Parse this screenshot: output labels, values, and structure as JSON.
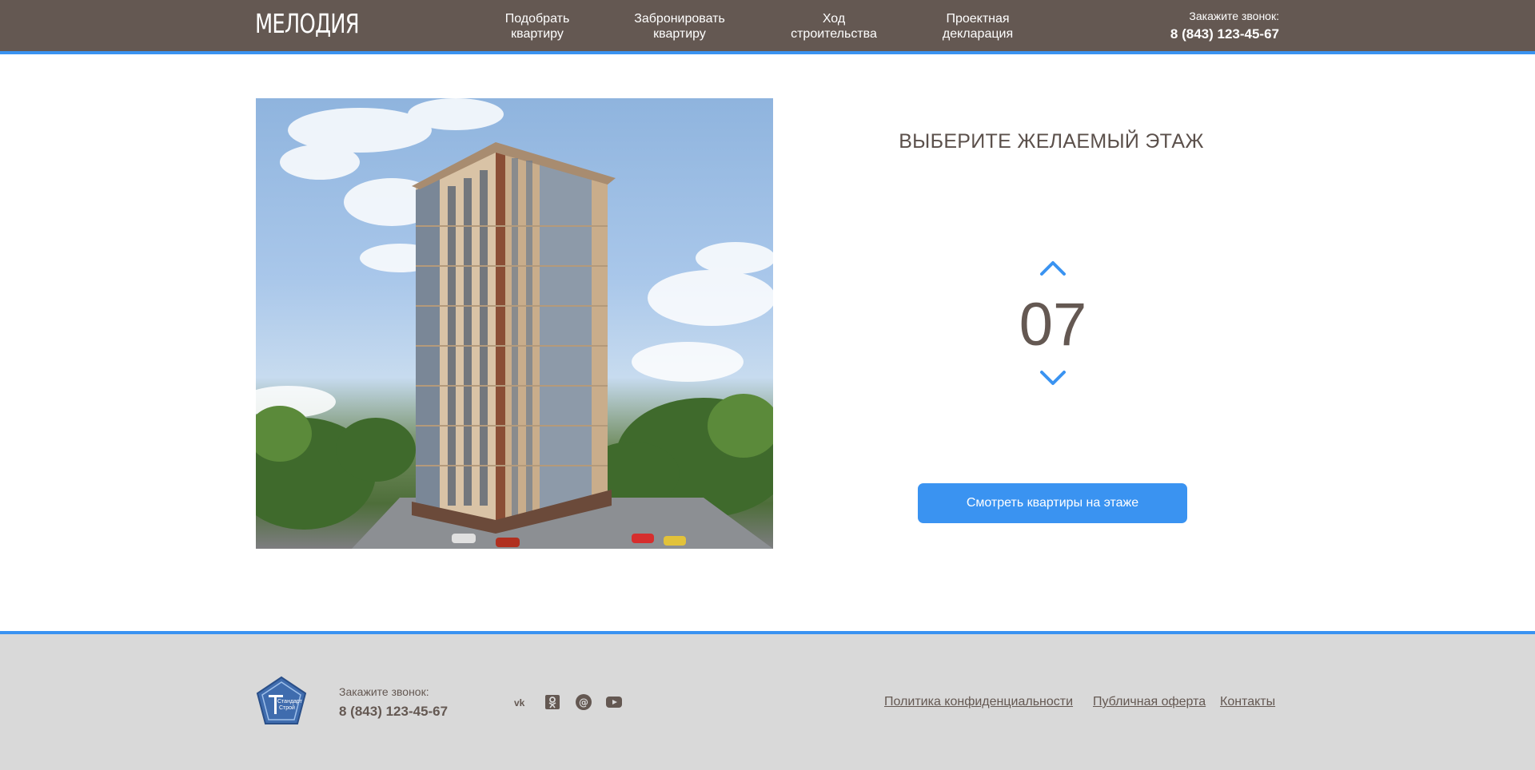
{
  "header": {
    "logo": "МЕЛОДИЯ",
    "nav": [
      {
        "line1": "Подобрать",
        "line2": "квартиру"
      },
      {
        "line1": "Забронировать",
        "line2": "квартиру"
      },
      {
        "line1": "Ход",
        "line2": "строительства"
      },
      {
        "line1": "Проектная",
        "line2": "декларация"
      }
    ],
    "call_label": "Закажите звонок:",
    "phone": "8 (843) 123-45-67"
  },
  "floor_picker": {
    "title": "ВЫБЕРИТЕ ЖЕЛАЕМЫЙ ЭТАЖ",
    "value": "07",
    "button_label": "Смотреть квартиры на этаже"
  },
  "footer": {
    "logo_text_line1": "Стандарт",
    "logo_text_line2": "Строй",
    "call_label": "Закажите звонок:",
    "phone": "8 (843) 123-45-67",
    "social": [
      "vk-icon",
      "odnoklassniki-icon",
      "mail-icon",
      "youtube-icon"
    ],
    "links": [
      "Политика конфиденциальности",
      "Публичная оферта",
      "Контакты"
    ]
  },
  "colors": {
    "header_bg": "#645852",
    "accent": "#3a93f1",
    "footer_bg": "#d9d9d9",
    "text_brown": "#645852"
  }
}
